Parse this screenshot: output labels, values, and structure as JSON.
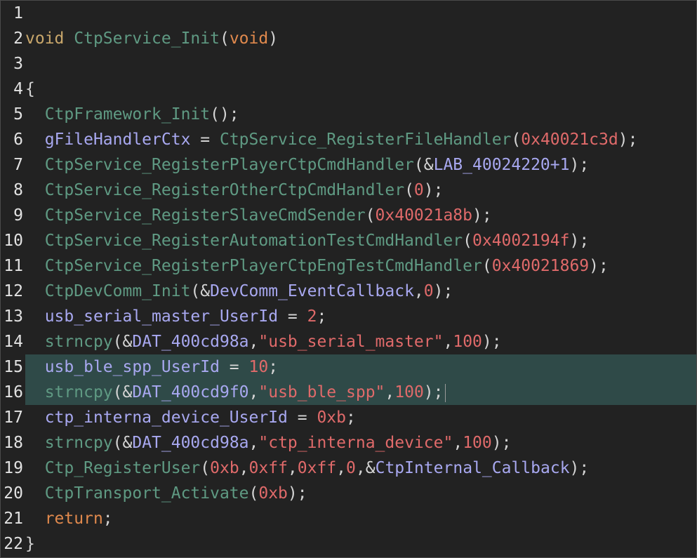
{
  "colors": {
    "background": "#222222",
    "highlight": "#2f4a48",
    "keyword": "#c9a76b",
    "function": "#5f9a83",
    "variable": "#a8a8f0",
    "number": "#e06a6a",
    "string": "#e06a6a"
  },
  "highlighted_lines": [
    15,
    16
  ],
  "lines": [
    {
      "n": "1",
      "tokens": []
    },
    {
      "n": "2",
      "tokens": [
        {
          "t": "kw",
          "v": "void"
        },
        {
          "t": "plain",
          "v": " "
        },
        {
          "t": "fn",
          "v": "CtpService_Init"
        },
        {
          "t": "pun",
          "v": "("
        },
        {
          "t": "kw2",
          "v": "void"
        },
        {
          "t": "pun",
          "v": ")"
        }
      ]
    },
    {
      "n": "3",
      "tokens": []
    },
    {
      "n": "4",
      "tokens": [
        {
          "t": "pun",
          "v": "{"
        }
      ]
    },
    {
      "n": "5",
      "tokens": [
        {
          "t": "plain",
          "v": "  "
        },
        {
          "t": "fn",
          "v": "CtpFramework_Init"
        },
        {
          "t": "pun",
          "v": "();"
        }
      ]
    },
    {
      "n": "6",
      "tokens": [
        {
          "t": "plain",
          "v": "  "
        },
        {
          "t": "var",
          "v": "gFileHandlerCtx"
        },
        {
          "t": "pun",
          "v": " = "
        },
        {
          "t": "fn",
          "v": "CtpService_RegisterFileHandler"
        },
        {
          "t": "pun",
          "v": "("
        },
        {
          "t": "num",
          "v": "0x40021c3d"
        },
        {
          "t": "pun",
          "v": ");"
        }
      ]
    },
    {
      "n": "7",
      "tokens": [
        {
          "t": "plain",
          "v": "  "
        },
        {
          "t": "fn",
          "v": "CtpService_RegisterPlayerCtpCmdHandler"
        },
        {
          "t": "pun",
          "v": "(&"
        },
        {
          "t": "var",
          "v": "LAB_40024220+1"
        },
        {
          "t": "pun",
          "v": ");"
        }
      ]
    },
    {
      "n": "8",
      "tokens": [
        {
          "t": "plain",
          "v": "  "
        },
        {
          "t": "fn",
          "v": "CtpService_RegisterOtherCtpCmdHandler"
        },
        {
          "t": "pun",
          "v": "("
        },
        {
          "t": "num",
          "v": "0"
        },
        {
          "t": "pun",
          "v": ");"
        }
      ]
    },
    {
      "n": "9",
      "tokens": [
        {
          "t": "plain",
          "v": "  "
        },
        {
          "t": "fn",
          "v": "CtpService_RegisterSlaveCmdSender"
        },
        {
          "t": "pun",
          "v": "("
        },
        {
          "t": "num",
          "v": "0x40021a8b"
        },
        {
          "t": "pun",
          "v": ");"
        }
      ]
    },
    {
      "n": "10",
      "tokens": [
        {
          "t": "plain",
          "v": "  "
        },
        {
          "t": "fn",
          "v": "CtpService_RegisterAutomationTestCmdHandler"
        },
        {
          "t": "pun",
          "v": "("
        },
        {
          "t": "num",
          "v": "0x4002194f"
        },
        {
          "t": "pun",
          "v": ");"
        }
      ]
    },
    {
      "n": "11",
      "tokens": [
        {
          "t": "plain",
          "v": "  "
        },
        {
          "t": "fn",
          "v": "CtpService_RegisterPlayerCtpEngTestCmdHandler"
        },
        {
          "t": "pun",
          "v": "("
        },
        {
          "t": "num",
          "v": "0x40021869"
        },
        {
          "t": "pun",
          "v": ");"
        }
      ]
    },
    {
      "n": "12",
      "tokens": [
        {
          "t": "plain",
          "v": "  "
        },
        {
          "t": "fn",
          "v": "CtpDevComm_Init"
        },
        {
          "t": "pun",
          "v": "(&"
        },
        {
          "t": "var",
          "v": "DevComm_EventCallback"
        },
        {
          "t": "pun",
          "v": ","
        },
        {
          "t": "num",
          "v": "0"
        },
        {
          "t": "pun",
          "v": ");"
        }
      ]
    },
    {
      "n": "13",
      "tokens": [
        {
          "t": "plain",
          "v": "  "
        },
        {
          "t": "var",
          "v": "usb_serial_master_UserId"
        },
        {
          "t": "pun",
          "v": " = "
        },
        {
          "t": "num",
          "v": "2"
        },
        {
          "t": "pun",
          "v": ";"
        }
      ]
    },
    {
      "n": "14",
      "tokens": [
        {
          "t": "plain",
          "v": "  "
        },
        {
          "t": "fn",
          "v": "strncpy"
        },
        {
          "t": "pun",
          "v": "(&"
        },
        {
          "t": "var",
          "v": "DAT_400cd98a"
        },
        {
          "t": "pun",
          "v": ","
        },
        {
          "t": "str",
          "v": "\"usb_serial_master\""
        },
        {
          "t": "pun",
          "v": ","
        },
        {
          "t": "num",
          "v": "100"
        },
        {
          "t": "pun",
          "v": ");"
        }
      ]
    },
    {
      "n": "15",
      "tokens": [
        {
          "t": "plain",
          "v": "  "
        },
        {
          "t": "var",
          "v": "usb_ble_spp_UserId"
        },
        {
          "t": "pun",
          "v": " = "
        },
        {
          "t": "num",
          "v": "10"
        },
        {
          "t": "pun",
          "v": ";"
        }
      ]
    },
    {
      "n": "16",
      "cursor": true,
      "tokens": [
        {
          "t": "plain",
          "v": "  "
        },
        {
          "t": "fn",
          "v": "strncpy"
        },
        {
          "t": "pun",
          "v": "(&"
        },
        {
          "t": "var",
          "v": "DAT_400cd9f0"
        },
        {
          "t": "pun",
          "v": ","
        },
        {
          "t": "str",
          "v": "\"usb_ble_spp\""
        },
        {
          "t": "pun",
          "v": ","
        },
        {
          "t": "num",
          "v": "100"
        },
        {
          "t": "pun",
          "v": ");"
        }
      ]
    },
    {
      "n": "17",
      "tokens": [
        {
          "t": "plain",
          "v": "  "
        },
        {
          "t": "var",
          "v": "ctp_interna_device_UserId"
        },
        {
          "t": "pun",
          "v": " = "
        },
        {
          "t": "num",
          "v": "0xb"
        },
        {
          "t": "pun",
          "v": ";"
        }
      ]
    },
    {
      "n": "18",
      "tokens": [
        {
          "t": "plain",
          "v": "  "
        },
        {
          "t": "fn",
          "v": "strncpy"
        },
        {
          "t": "pun",
          "v": "(&"
        },
        {
          "t": "var",
          "v": "DAT_400cd98a"
        },
        {
          "t": "pun",
          "v": ","
        },
        {
          "t": "str",
          "v": "\"ctp_interna_device\""
        },
        {
          "t": "pun",
          "v": ","
        },
        {
          "t": "num",
          "v": "100"
        },
        {
          "t": "pun",
          "v": ");"
        }
      ]
    },
    {
      "n": "19",
      "tokens": [
        {
          "t": "plain",
          "v": "  "
        },
        {
          "t": "fn",
          "v": "Ctp_RegisterUser"
        },
        {
          "t": "pun",
          "v": "("
        },
        {
          "t": "num",
          "v": "0xb"
        },
        {
          "t": "pun",
          "v": ","
        },
        {
          "t": "num",
          "v": "0xff"
        },
        {
          "t": "pun",
          "v": ","
        },
        {
          "t": "num",
          "v": "0xff"
        },
        {
          "t": "pun",
          "v": ","
        },
        {
          "t": "num",
          "v": "0"
        },
        {
          "t": "pun",
          "v": ",&"
        },
        {
          "t": "var",
          "v": "CtpInternal_Callback"
        },
        {
          "t": "pun",
          "v": ");"
        }
      ]
    },
    {
      "n": "20",
      "tokens": [
        {
          "t": "plain",
          "v": "  "
        },
        {
          "t": "fn",
          "v": "CtpTransport_Activate"
        },
        {
          "t": "pun",
          "v": "("
        },
        {
          "t": "num",
          "v": "0xb"
        },
        {
          "t": "pun",
          "v": ");"
        }
      ]
    },
    {
      "n": "21",
      "tokens": [
        {
          "t": "plain",
          "v": "  "
        },
        {
          "t": "kw2",
          "v": "return"
        },
        {
          "t": "pun",
          "v": ";"
        }
      ]
    },
    {
      "n": "22",
      "tokens": [
        {
          "t": "pun",
          "v": "}"
        }
      ]
    }
  ]
}
